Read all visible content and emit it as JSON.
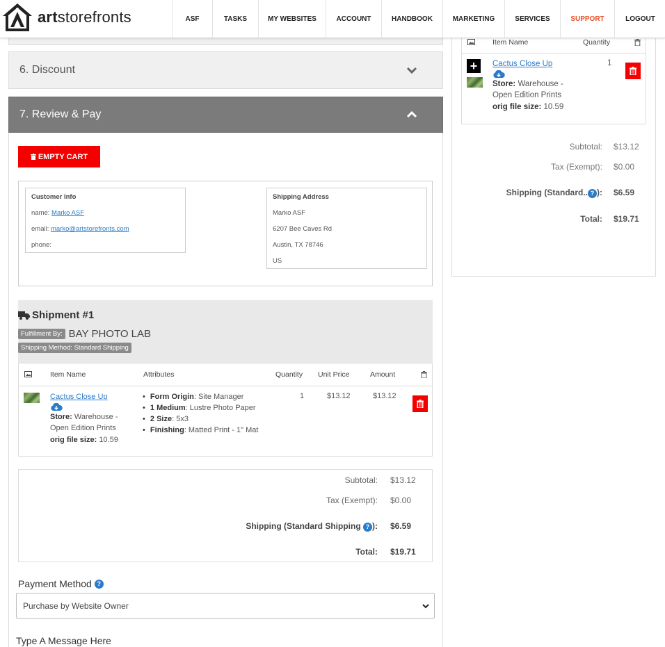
{
  "brand": {
    "name_bold": "art",
    "name_rest": "storefronts"
  },
  "nav": [
    {
      "label": "ASF",
      "width": 58
    },
    {
      "label": "TASKS",
      "width": 66
    },
    {
      "label": "MY WEBSITES",
      "width": 97
    },
    {
      "label": "ACCOUNT",
      "width": 80
    },
    {
      "label": "HANDBOOK",
      "width": 88
    },
    {
      "label": "MARKETING",
      "width": 89
    },
    {
      "label": "SERVICES",
      "width": 80
    },
    {
      "label": "SUPPORT",
      "width": 78
    },
    {
      "label": "LOGOUT",
      "width": 74
    }
  ],
  "accordion": {
    "discount_title": "6. Discount",
    "review_title": "7. Review & Pay"
  },
  "buttons": {
    "empty_cart": "EMPTY CART"
  },
  "customer": {
    "title": "Customer Info",
    "name_label": "name:",
    "name_value": "Marko ASF",
    "email_label": "email:",
    "email_value": "marko@artstorefronts.com",
    "phone_label": "phone:"
  },
  "shipping_address": {
    "title": "Shipping Address",
    "name": "Marko ASF",
    "street": "6207 Bee Caves Rd",
    "city": "Austin, TX 78746",
    "country": "US"
  },
  "shipment": {
    "title": "Shipment #1",
    "fulfillment_label": "Fulfillment By:",
    "fulfillment_value": "BAY PHOTO LAB",
    "method": "Shipping Method: Standard Shipping",
    "columns": {
      "item_name": "Item Name",
      "attributes": "Attributes",
      "quantity": "Quantity",
      "unit_price": "Unit Price",
      "amount": "Amount"
    },
    "item": {
      "name": "Cactus Close Up",
      "store_label": "Store:",
      "store_value_1": "Warehouse -",
      "store_value_2": "Open Edition Prints",
      "file_label": "orig file size:",
      "file_value": "10.59",
      "quantity": "1",
      "unit_price": "$13.12",
      "amount": "$13.12",
      "attributes": [
        {
          "name": "Form Origin",
          "value": ": Site Manager"
        },
        {
          "name": "1 Medium",
          "value": ": Lustre Photo Paper"
        },
        {
          "name": "2 Size",
          "value": ": 5x3"
        },
        {
          "name": "Finishing",
          "value": ": Matted Print - 1\" Mat"
        }
      ]
    }
  },
  "totals": {
    "subtotal_label": "Subtotal:",
    "subtotal": "$13.12",
    "tax_label": "Tax (Exempt):",
    "tax": "$0.00",
    "shipping_label": "Shipping (Standard Shipping",
    "shipping": "$6.59",
    "total_label": "Total:",
    "total": "$19.71"
  },
  "payment": {
    "label": "Payment Method",
    "selected": "Purchase by Website Owner",
    "message_label": "Type A Message Here"
  },
  "cart": {
    "col_item": "Item Name",
    "col_quantity": "Quantity",
    "item_name": "Cactus Close Up",
    "quantity": "1",
    "store_label": "Store:",
    "store_value_1": "Warehouse -",
    "store_value_2": "Open Edition Prints",
    "file_label": "orig file size:",
    "file_value": "10.59",
    "subtotal_label": "Subtotal:",
    "subtotal": "$13.12",
    "tax_label": "Tax (Exempt):",
    "tax": "$0.00",
    "shipping_label": "Shipping (Standard..",
    "shipping": "$6.59",
    "total_label": "Total:",
    "total": "$19.71"
  },
  "colors": {
    "danger": "#f40000",
    "link": "#2a7bc8",
    "support": "#e8502a",
    "accordion_active": "#7b7b7b"
  },
  "icons": [
    "logo-house-icon",
    "chevron-down-icon",
    "chevron-up-icon",
    "trash-icon",
    "truck-icon",
    "image-icon",
    "cloud-download-icon",
    "question-icon",
    "plus-icon",
    "select-caret-icon"
  ]
}
